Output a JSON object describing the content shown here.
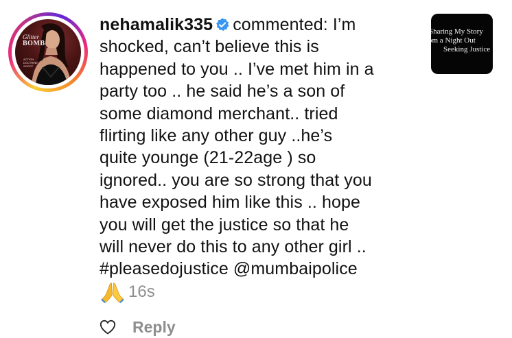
{
  "comment": {
    "username": "nehamalik335",
    "verified": true,
    "action": "commented:",
    "text_lines": [
      "I’m",
      "shocked, can’t  believe this is",
      "happened to you .. I’ve met him in a",
      "party too .. he said he’s a son of",
      "some diamond merchant.. tried",
      "flirting like any other guy ..he’s",
      "quite younge (21-22age ) so",
      "ignored.. you are so strong that you",
      "have exposed him like this .. hope",
      "you will get the justice so that he",
      "will never do this to any other girl ..",
      "#pleasedojustice @mumbaipolice"
    ],
    "emoji": "🙏",
    "timestamp": "16s"
  },
  "avatar": {
    "magazine_title_line1": "Glitter",
    "magazine_title_line2": "BOMB",
    "magazine_small_text": "ACTION DOCTRINE SHOOT"
  },
  "actions": {
    "like_icon": "heart-outline-icon",
    "reply_label": "Reply"
  },
  "post_thumbnail": {
    "lines": [
      "Sharing My Story",
      "om a Night Out",
      "Seeking Justice"
    ]
  },
  "colors": {
    "text": "#111111",
    "muted": "#8e8e8e",
    "verified": "#3897f0",
    "thumbnail_bg": "#050505"
  }
}
